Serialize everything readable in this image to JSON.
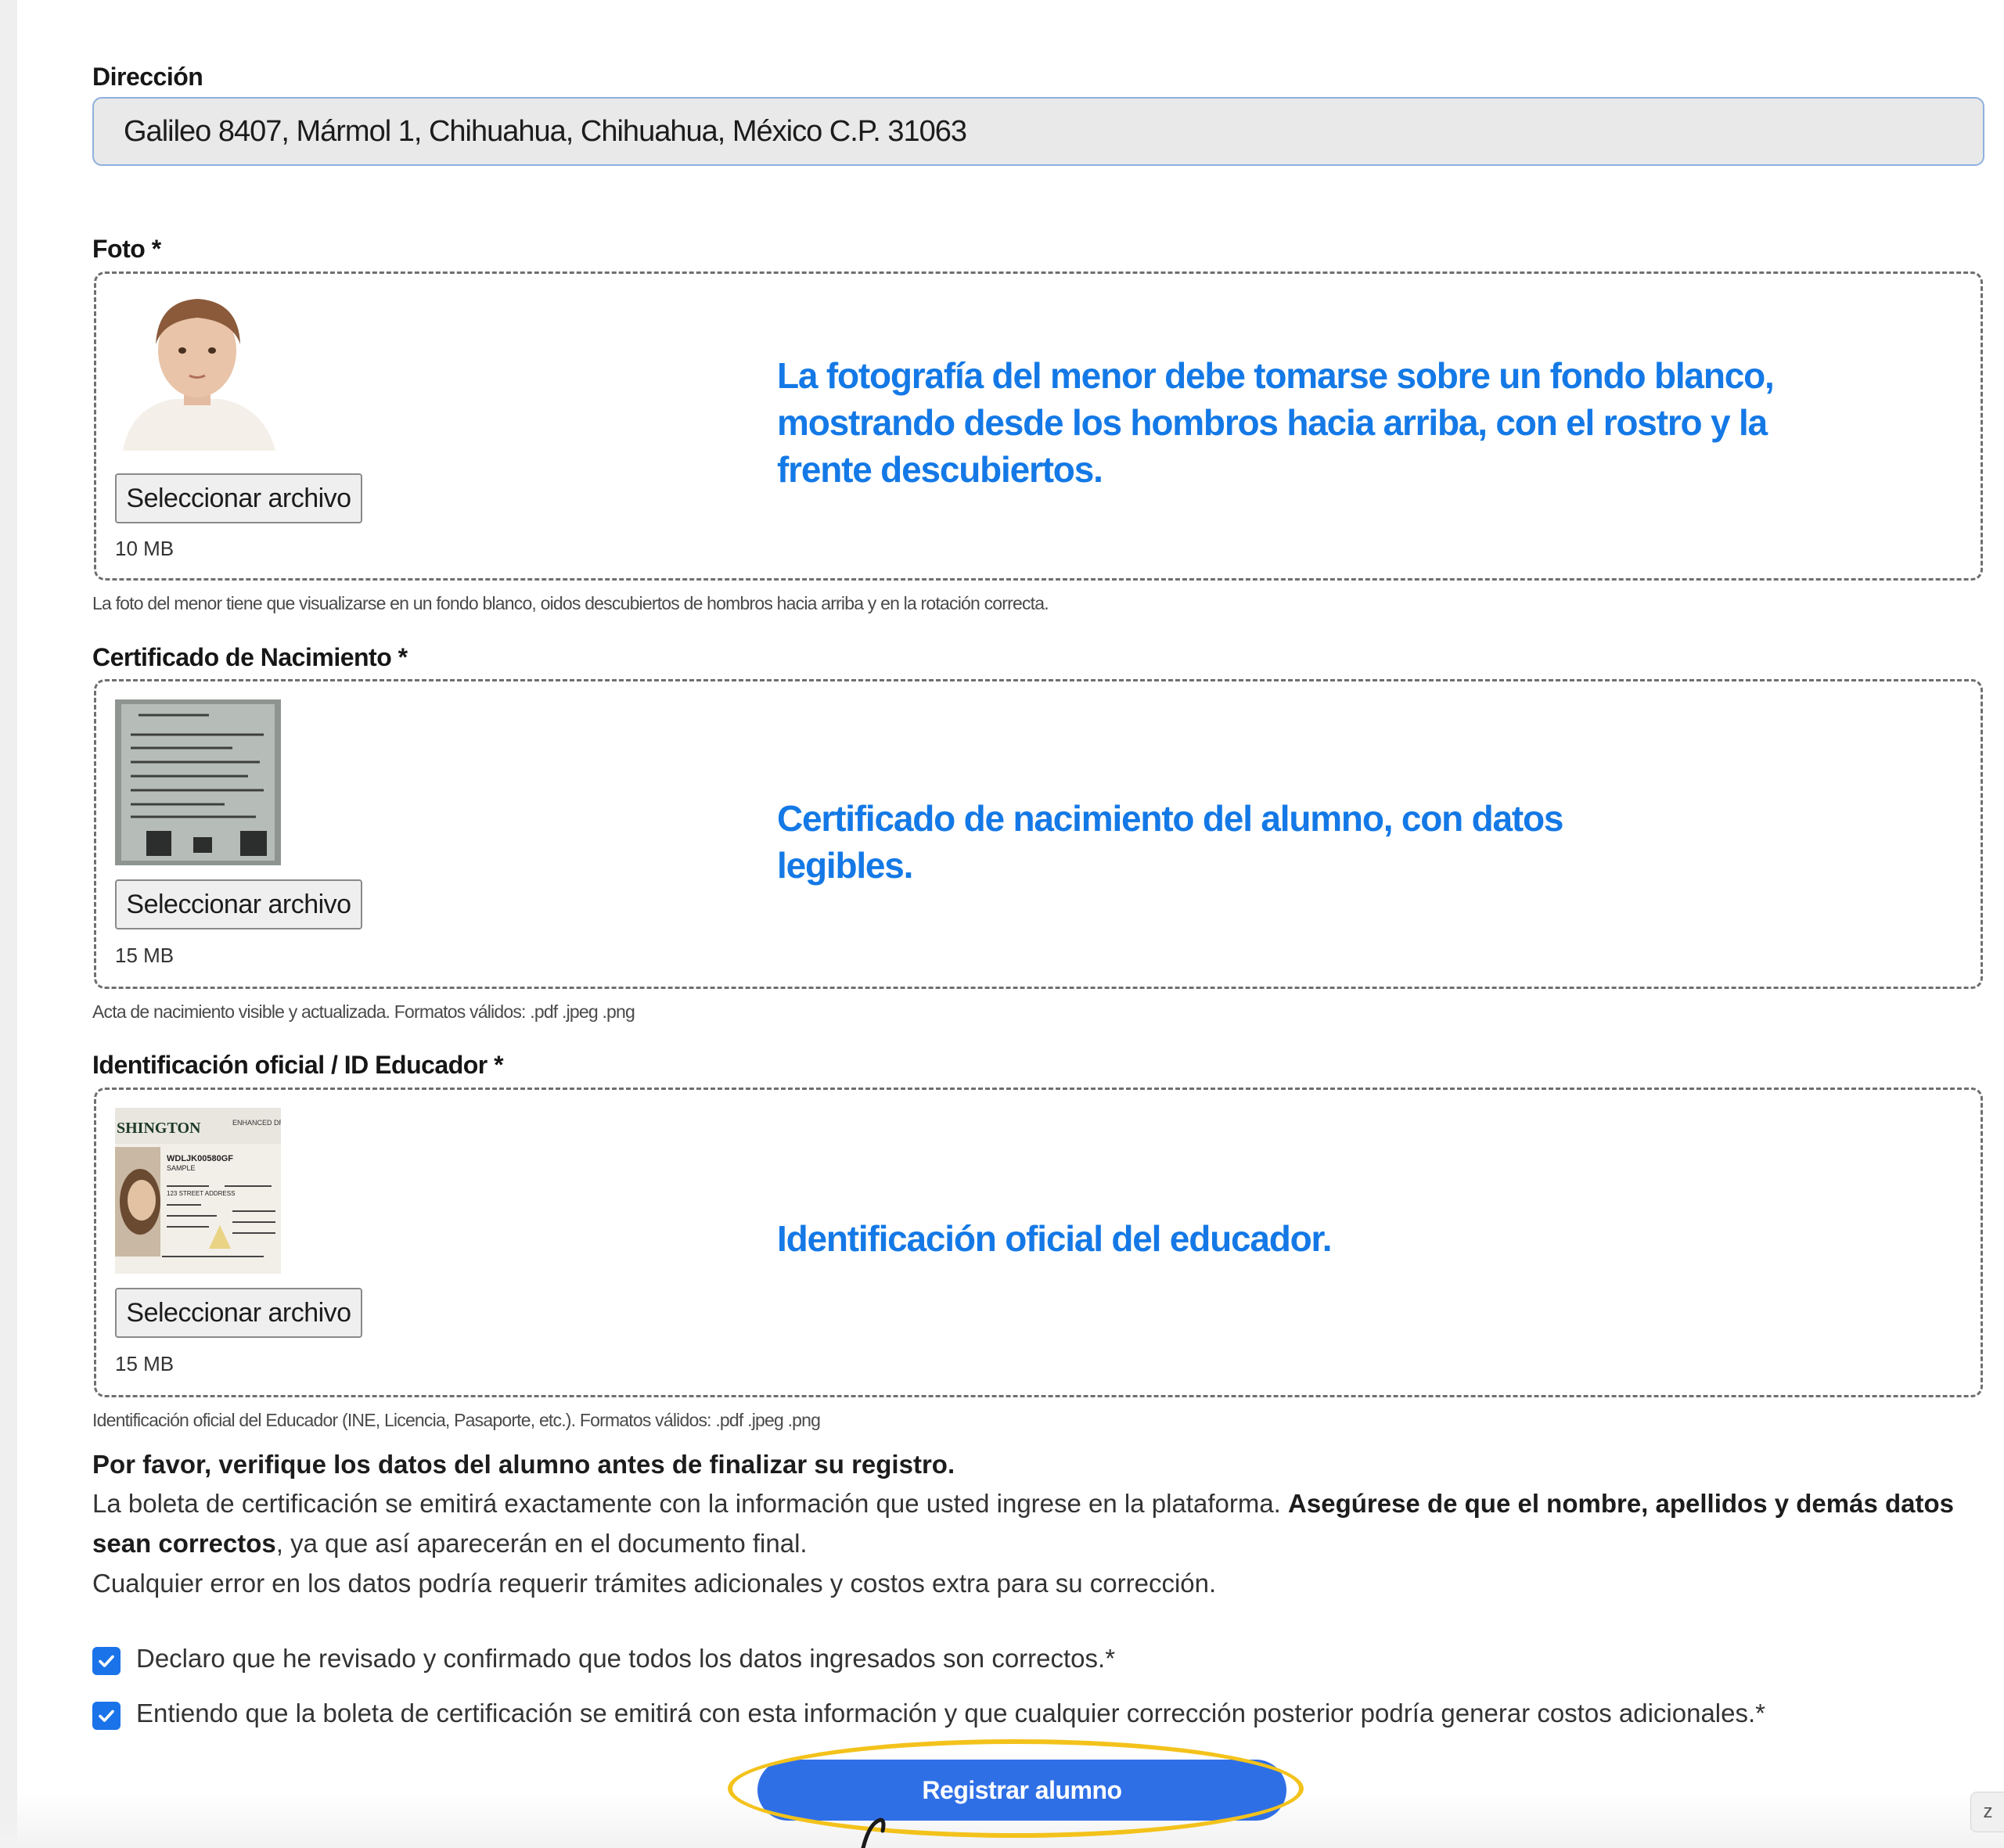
{
  "address": {
    "label": "Dirección",
    "value": "Galileo 8407, Mármol 1, Chihuahua, Chihuahua, México C.P. 31063"
  },
  "photo": {
    "label": "Foto *",
    "button": "Seleccionar archivo",
    "size": "10 MB",
    "hint": "La fotografía del menor debe tomarse sobre un fondo blanco, mostrando desde los hombros hacia arriba, con el rostro y la frente descubiertos.",
    "helper": "La foto del menor tiene que visualizarse en un fondo blanco, oidos descubiertos de hombros hacia arriba y en la rotación correcta."
  },
  "birth_certificate": {
    "label": "Certificado de Nacimiento *",
    "button": "Seleccionar archivo",
    "size": "15 MB",
    "hint": "Certificado de nacimiento del alumno, con datos legibles.",
    "helper": "Acta de nacimiento visible y actualizada. Formatos válidos: .pdf .jpeg .png"
  },
  "official_id": {
    "label": "Identificación oficial / ID Educador *",
    "button": "Seleccionar archivo",
    "size": "15 MB",
    "hint": "Identificación oficial del educador.",
    "helper": "Identificación oficial del Educador (INE, Licencia, Pasaporte, etc.). Formatos válidos: .pdf .jpeg .png",
    "card_text": {
      "state": "SHINGTON",
      "type": "ENHANCED DRIVER LICEN",
      "dl": "WDLJK00580GF",
      "name": "SAMPLE",
      "address": "123 STREET ADDRESS"
    }
  },
  "verification": {
    "title": "Por favor, verifique los datos del alumno antes de finalizar su registro.",
    "text_1": "La boleta de certificación se emitirá exactamente con la información que usted ingrese en la plataforma.",
    "text_bold": "Asegúrese de que el nombre, apellidos y demás datos sean correctos",
    "text_2": ", ya que así aparecerán en el documento final.",
    "text_3": "Cualquier error en los datos podría requerir trámites adicionales y costos extra para su corrección."
  },
  "checks": [
    {
      "label": "Declaro que he revisado y confirmado que todos los datos ingresados son correctos.*",
      "checked": true
    },
    {
      "label": "Entiendo que la boleta de certificación se emitirá con esta información y que cualquier corrección posterior podría generar costos adicionales.*",
      "checked": true
    }
  ],
  "submit": {
    "label": "Registrar alumno"
  },
  "side_chip": "z",
  "colors": {
    "hint_blue": "#1479e6",
    "button_blue": "#2f6fe6",
    "checkbox_blue": "#1a73e8",
    "highlight": "#f3c21b"
  },
  "icons": {
    "checkbox": "checkmark-icon"
  }
}
